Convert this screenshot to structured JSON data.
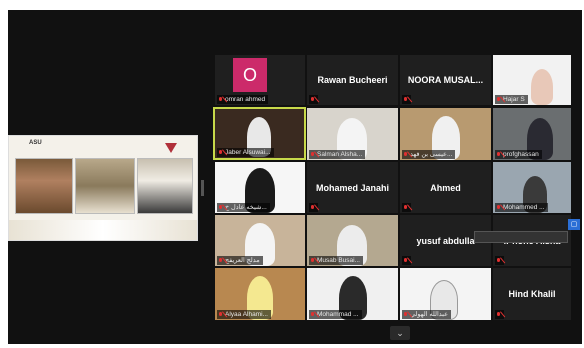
{
  "shared_screen": {
    "logo_text": "ASU"
  },
  "participants": [
    {
      "id": "p1",
      "display": "O",
      "label": "omran ahmed",
      "muted": true
    },
    {
      "id": "p2",
      "name": "Rawan Bucheeri",
      "label": "",
      "muted": true
    },
    {
      "id": "p3",
      "name": "NOORA  MUSAL...",
      "label": "",
      "muted": true
    },
    {
      "id": "p4",
      "label": "Hajar S",
      "muted": true
    },
    {
      "id": "p5",
      "label": "Jaber Alsuwai...",
      "muted": true,
      "active": true
    },
    {
      "id": "p6",
      "label": "Salman Alsha...",
      "muted": true
    },
    {
      "id": "p7",
      "label": "عيسى بن فهد...",
      "muted": true
    },
    {
      "id": "p8",
      "label": "profghassan",
      "muted": true
    },
    {
      "id": "p9",
      "label": "شيخه عادل خ...",
      "muted": true
    },
    {
      "id": "p10",
      "name": "Mohamed Janahi",
      "label": "",
      "muted": true
    },
    {
      "id": "p11",
      "name": "Ahmed",
      "label": "",
      "muted": true
    },
    {
      "id": "p12",
      "label": "Mohammed ...",
      "muted": true
    },
    {
      "id": "p13",
      "label": "مدلج العريفج",
      "muted": true
    },
    {
      "id": "p14",
      "label": "Musab Busai...",
      "muted": true
    },
    {
      "id": "p15",
      "name": "yusuf abdulla",
      "label": "",
      "muted": true
    },
    {
      "id": "p16",
      "name": "iPhone Aisha",
      "label": "",
      "muted": true
    },
    {
      "id": "p17",
      "label": "Alyaa Alhami...",
      "muted": true
    },
    {
      "id": "p18",
      "label": "Mohammad ...",
      "muted": true
    },
    {
      "id": "p19",
      "label": "عبدالله الهولي",
      "muted": true
    },
    {
      "id": "p20",
      "name": "Hind Khalil",
      "label": "",
      "muted": true
    }
  ],
  "controls": {
    "collapse_label": "⌄",
    "blue_button_label": "▢"
  },
  "colors": {
    "active_border": "#c7d94a",
    "avatar_bg": "#cc2a6a",
    "mute_red": "#e03030"
  }
}
